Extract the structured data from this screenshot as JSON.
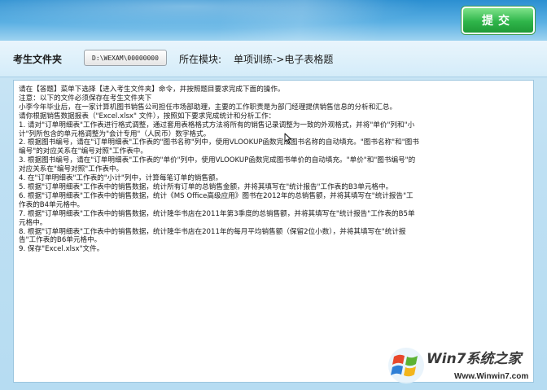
{
  "header": {
    "submit_label": "提交"
  },
  "infobar": {
    "folder_label": "考生文件夹",
    "folder_path": "D:\\WEXAM\\00000000",
    "module_label": "所在模块:",
    "module_name": "单项训练->电子表格题"
  },
  "content": {
    "lines": [
      "请在【答题】菜单下选择【进入考生文件夹】命令，并按照题目要求完成下面的操作。",
      "注意：以下的文件必须保存在考生文件夹下",
      "小李今年毕业后，在一家计算机图书销售公司担任市场部助理，主要的工作职责是为部门经理提供销售信息的分析和汇总。",
      "请你根据销售数据报表（\"Excel.xlsx\" 文件），按照如下要求完成统计和分析工作：",
      "1. 请对\"订单明细表\"工作表进行格式调整，通过套用表格格式方法将所有的销售记录调整为一致的外观格式，并将\"单价\"列和\"小",
      "计\"列所包含的单元格调整为\"会计专用\"（人民币）数字格式。",
      "2. 根据图书编号，请在\"订单明细表\"工作表的\"图书名称\"列中，使用VLOOKUP函数完成图书名称的自动填充。\"图书名称\"和\"图书",
      "编号\"的对应关系在\"编号对照\"工作表中。",
      "3. 根据图书编号，请在\"订单明细表\"工作表的\"单价\"列中，使用VLOOKUP函数完成图书单价的自动填充。\"单价\"和\"图书编号\"的",
      "对应关系在\"编号对照\"工作表中。",
      "4. 在\"订单明细表\"工作表的\"小计\"列中，计算每笔订单的销售额。",
      "5. 根据\"订单明细表\"工作表中的销售数据，统计所有订单的总销售金额，并将其填写在\"统计报告\"工作表的B3单元格中。",
      "6. 根据\"订单明细表\"工作表中的销售数据，统计《MS Office高级应用》图书在2012年的总销售额，并将其填写在\"统计报告\"工",
      "作表的B4单元格中。",
      "7. 根据\"订单明细表\"工作表中的销售数据，统计隆华书店在2011年第3季度的总销售额，并将其填写在\"统计报告\"工作表的B5单",
      "元格中。",
      "8. 根据\"订单明细表\"工作表中的销售数据，统计隆华书店在2011年的每月平均销售额（保留2位小数），并将其填写在\"统计报",
      "告\"工作表的B6单元格中。",
      "9. 保存\"Excel.xlsx\"文件。"
    ]
  },
  "watermark": {
    "title": "Win7系统之家",
    "url": "Www.Winwin7.com"
  },
  "colors": {
    "header_blue": "#2b8fd1",
    "submit_green": "#2fb54a",
    "panel_bg": "#ffffff"
  },
  "icons": {
    "cursor": "mouse-pointer-icon",
    "watermark_logo": "windows-logo-icon"
  }
}
